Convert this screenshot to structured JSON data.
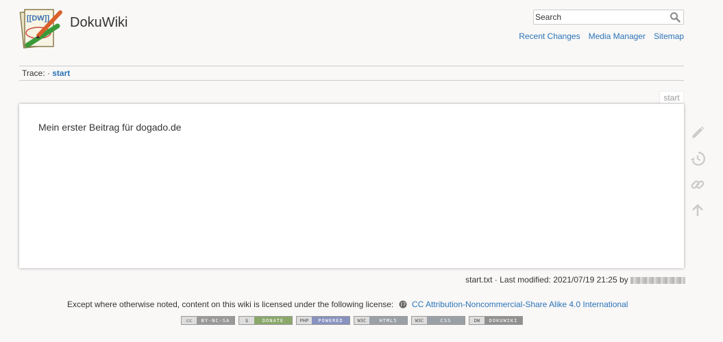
{
  "header": {
    "site_title": "DokuWiki",
    "logo_text": "[[DW]]",
    "logo_icon": "dokuwiki-logo",
    "search": {
      "placeholder": "Search",
      "icon": "magnifier-icon"
    },
    "tools": [
      "Recent Changes",
      "Media Manager",
      "Sitemap"
    ]
  },
  "breadcrumbs": {
    "label": "Trace:",
    "separator": "·",
    "current": "start"
  },
  "page": {
    "id": "start",
    "content": "Mein erster Beitrag für dogado.de"
  },
  "pagetools": [
    "edit-icon",
    "revisions-icon",
    "backlinks-icon",
    "back-to-top-icon"
  ],
  "docinfo": {
    "filename": "start.txt",
    "separator": "·",
    "modified_label": "Last modified:",
    "date": "2021/07/19 21:25",
    "by": "by"
  },
  "footer": {
    "license_text": "Except where otherwise noted, content on this wiki is licensed under the following license:",
    "license_link": "CC Attribution-Noncommercial-Share Alike 4.0 International",
    "badges": [
      {
        "left": "cc",
        "right": "BY-NC-SA",
        "color": "#999999"
      },
      {
        "left": "$",
        "right": "DONATE",
        "color": "#8aa86a"
      },
      {
        "left": "PHP",
        "right": "POWERED",
        "color": "#8892bf"
      },
      {
        "left": "W3C",
        "right": "HTML5",
        "color": "#9aa0a6"
      },
      {
        "left": "W3C",
        "right": "CSS",
        "color": "#9aa0a6"
      },
      {
        "left": "DW",
        "right": "DOKUWIKI",
        "color": "#909090"
      }
    ]
  },
  "colors": {
    "link": "#2b73b7",
    "background": "#f9f8f7",
    "page": "#ffffff",
    "icon": "#cccccc"
  }
}
